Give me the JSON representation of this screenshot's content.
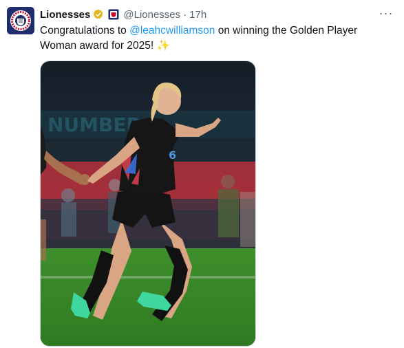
{
  "tweet": {
    "author_name": "Lionesses",
    "handle": "@Lionesses",
    "separator": "·",
    "time": "17h",
    "text_before": "Congratulations to ",
    "mention": "@leahcwilliamson",
    "text_after": " on winning the Golden Player Woman award for 2025! ✨",
    "more_label": "···"
  },
  "icons": {
    "avatar": "england-crest-avatar",
    "verified": "gold-verified-badge",
    "flag": "affiliate-crest-icon",
    "more": "more-options-icon"
  },
  "colors": {
    "link": "#1d9bf0",
    "secondary_text": "#536471",
    "verified_gold": "#e2b719",
    "pitch_green": "#3f8f2c",
    "kit_black": "#141414",
    "boot_green": "#3fd6a0"
  }
}
